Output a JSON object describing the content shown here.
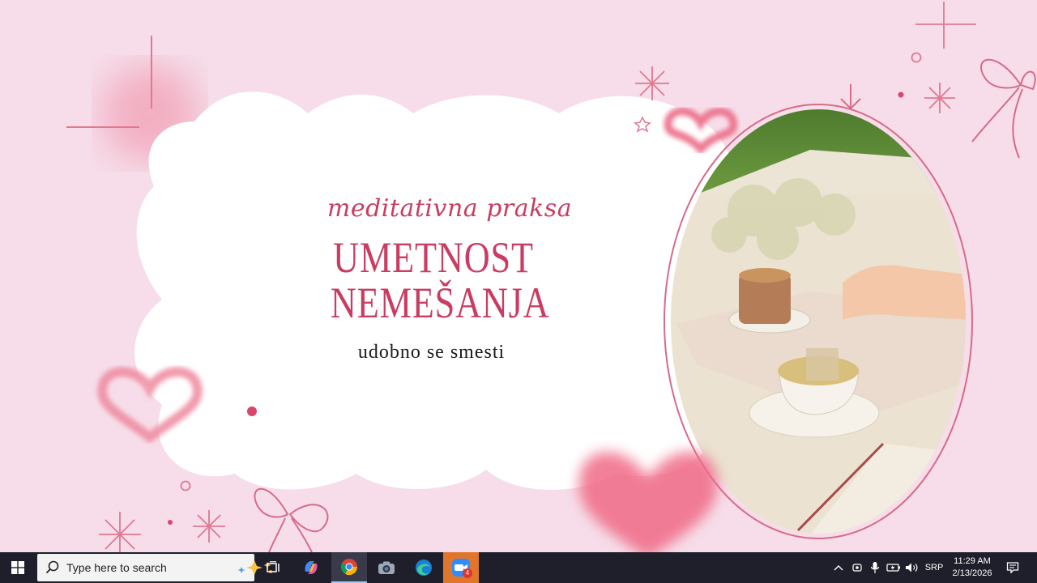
{
  "slide": {
    "kicker": "meditativna praksa",
    "headline_line1": "UMETNOST",
    "headline_line2": "NEMEŠANJA",
    "subtitle": "udobno se smesti",
    "colors": {
      "background": "#f6dde9",
      "accent": "#c93d62",
      "heart": "#f07a92",
      "card": "#ffffff"
    }
  },
  "taskbar": {
    "search_placeholder": "Type here to search",
    "apps": [
      {
        "name": "task-view-icon"
      },
      {
        "name": "copilot-icon"
      },
      {
        "name": "chrome-icon",
        "active": true
      },
      {
        "name": "camera-icon"
      },
      {
        "name": "edge-icon"
      },
      {
        "name": "zoom-icon",
        "badge": "4"
      }
    ],
    "tray": {
      "language": "SRP"
    },
    "clock": {
      "time": "11:29 AM",
      "date": "2/13/2026"
    }
  }
}
